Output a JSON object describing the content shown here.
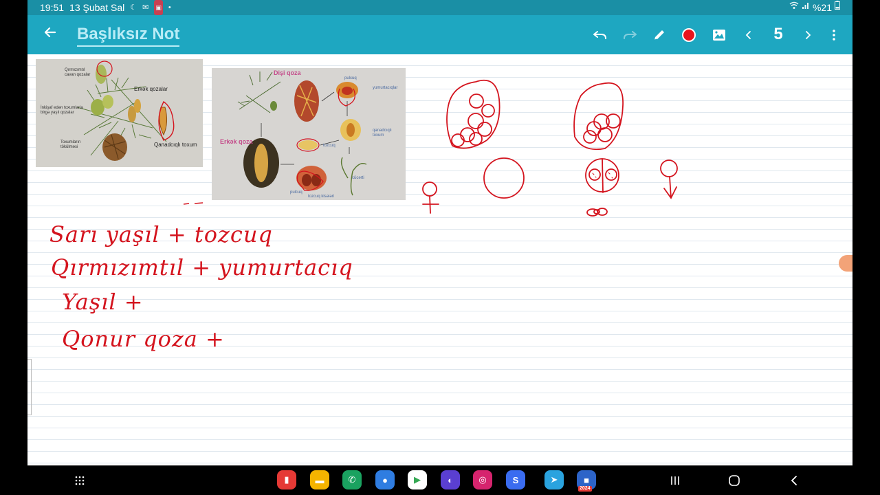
{
  "status_bar": {
    "time": "19:51",
    "date": "13 Şubat Sal",
    "battery": "%21",
    "notif_icons": [
      "moon-icon",
      "mail-icon",
      "app-badge-icon",
      "dot-icon"
    ],
    "system_icons": [
      "wifi-icon",
      "signal-icon",
      "battery-icon"
    ]
  },
  "toolbar": {
    "title": "Başlıksız Not",
    "page_number": "5",
    "pen_color": "#e8141c",
    "icons": [
      "back-arrow-icon",
      "undo-icon",
      "redo-icon",
      "pen-icon",
      "color-icon",
      "image-icon",
      "prev-page-icon",
      "next-page-icon",
      "more-menu-icon"
    ]
  },
  "photo1": {
    "labels": {
      "qirmizimtil": "Qırmızımtıl\ncavan qozalar",
      "erkek": "Erkək qozalar",
      "inkisaf": "İnkişaf edən toxumlarla\nbirgə yaşıl qozalar",
      "toxumlarin": "Toxumların\ntökülməsi",
      "qanadcigli": "Qanadcıqlı toxum"
    }
  },
  "photo2": {
    "labels": {
      "disi": "Dişi qoza",
      "puleyic": "pulcuq",
      "yumurtaciqlar": "yumurtacıqlar",
      "erkek_qoza": "Erkək qoza",
      "tozcuq": "tozcuq",
      "qanadcigli_toxum": "qanadcıqlı\ntoxum",
      "cucerti": "cücərti",
      "pulcuq2": "pulcuq",
      "tozcuq_kiseleri": "tozcuq kisələri"
    }
  },
  "handwriting": {
    "line1": "Sarı yaşıl + tozcuq",
    "line2": "Qırmızımtıl + yumurtacıq",
    "line3": "Yaşıl +",
    "line4": "Qonur qoza +"
  },
  "ink_color": "#d4141e",
  "dock": {
    "apps": [
      {
        "name": "flipboard-app-icon",
        "color": "#e53935",
        "glyph": "▮"
      },
      {
        "name": "files-app-icon",
        "color": "#f4b400",
        "glyph": "▬"
      },
      {
        "name": "phone-app-icon",
        "color": "#1aa260",
        "glyph": "✆"
      },
      {
        "name": "messages-app-icon",
        "color": "#2f7de1",
        "glyph": "●"
      },
      {
        "name": "play-store-app-icon",
        "color": "#ffffff",
        "glyph": "▶"
      },
      {
        "name": "internet-app-icon",
        "color": "#5a3fd1",
        "glyph": "◐"
      },
      {
        "name": "instagram-app-icon",
        "color": "#d6246e",
        "glyph": "◎"
      },
      {
        "name": "shazam-app-icon",
        "color": "#3a6cf0",
        "glyph": "S"
      },
      {
        "name": "telegram-app-icon",
        "color": "#2aa3df",
        "glyph": "➤"
      },
      {
        "name": "recorder-app-icon",
        "color": "#2d64c8",
        "glyph": "■"
      }
    ],
    "recorder_badge": "2024"
  },
  "navigation": [
    "app-drawer-icon",
    "recents-icon",
    "home-icon",
    "back-icon"
  ]
}
